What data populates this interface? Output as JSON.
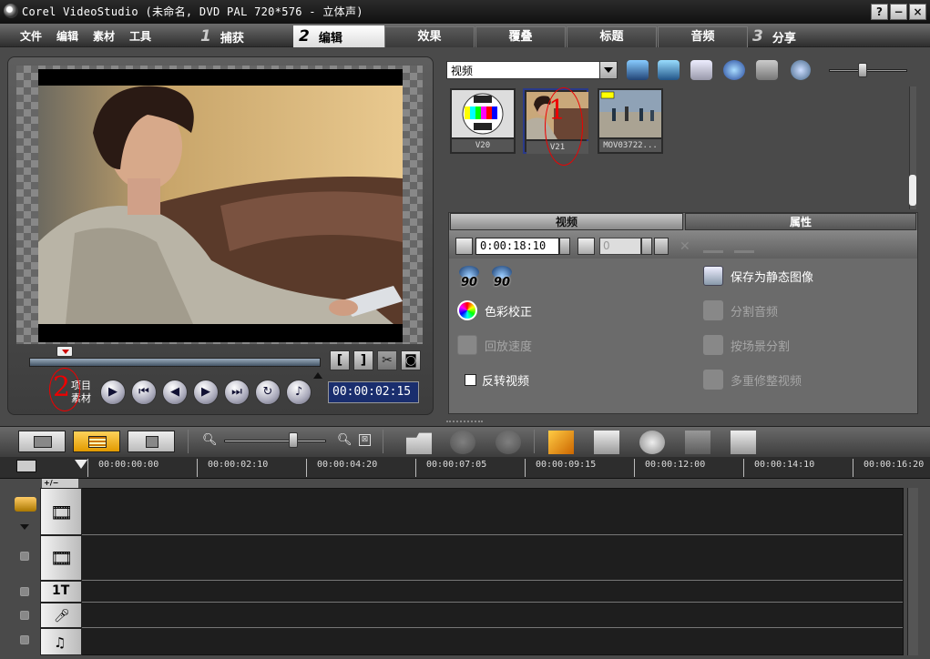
{
  "window": {
    "title": "Corel VideoStudio (未命名, DVD PAL 720*576 - 立体声)",
    "controls": [
      "?",
      "−",
      "×"
    ]
  },
  "menu": [
    "文件",
    "编辑",
    "素材",
    "工具"
  ],
  "steps": [
    {
      "num": "1",
      "label": "捕获"
    },
    {
      "num": "2",
      "label": "编辑"
    },
    {
      "num": "3",
      "label": "分享"
    }
  ],
  "tabs": [
    "效果",
    "覆叠",
    "标题",
    "音频"
  ],
  "preview": {
    "mode_project": "项目",
    "mode_clip": "素材",
    "timecode": "00:00:02:15",
    "mark_in": "[",
    "mark_out": "]"
  },
  "library": {
    "selected": "视频",
    "thumbnails": [
      "V20",
      "V21",
      "MOV03722..."
    ],
    "zoom_level": 0.4
  },
  "options": {
    "tab_video": "视频",
    "tab_attributes": "属性",
    "duration": "0:00:18:10",
    "volume": "0",
    "rotate_left": "90",
    "rotate_right": "90",
    "color_correction": "色彩校正",
    "playback_speed": "回放速度",
    "reverse_video": "反转视频",
    "save_still": "保存为静态图像",
    "split_audio": "分割音频",
    "scene_split": "按场景分割",
    "multi_trim": "多重修整视频"
  },
  "annotations": [
    "1",
    "2"
  ],
  "timeline": {
    "ruler": [
      "00:00:00:00",
      "00:00:02:10",
      "00:00:04:20",
      "00:00:07:05",
      "00:00:09:15",
      "00:00:12:00",
      "00:00:14:10",
      "00:00:16:20"
    ],
    "add_remove": "+/−",
    "title_track_label": "1T",
    "zoom_level": 0.7
  },
  "colors": {
    "accent": "#f0a800",
    "timecode_bg": "#1a2e6e",
    "annotation": "#e00000"
  }
}
